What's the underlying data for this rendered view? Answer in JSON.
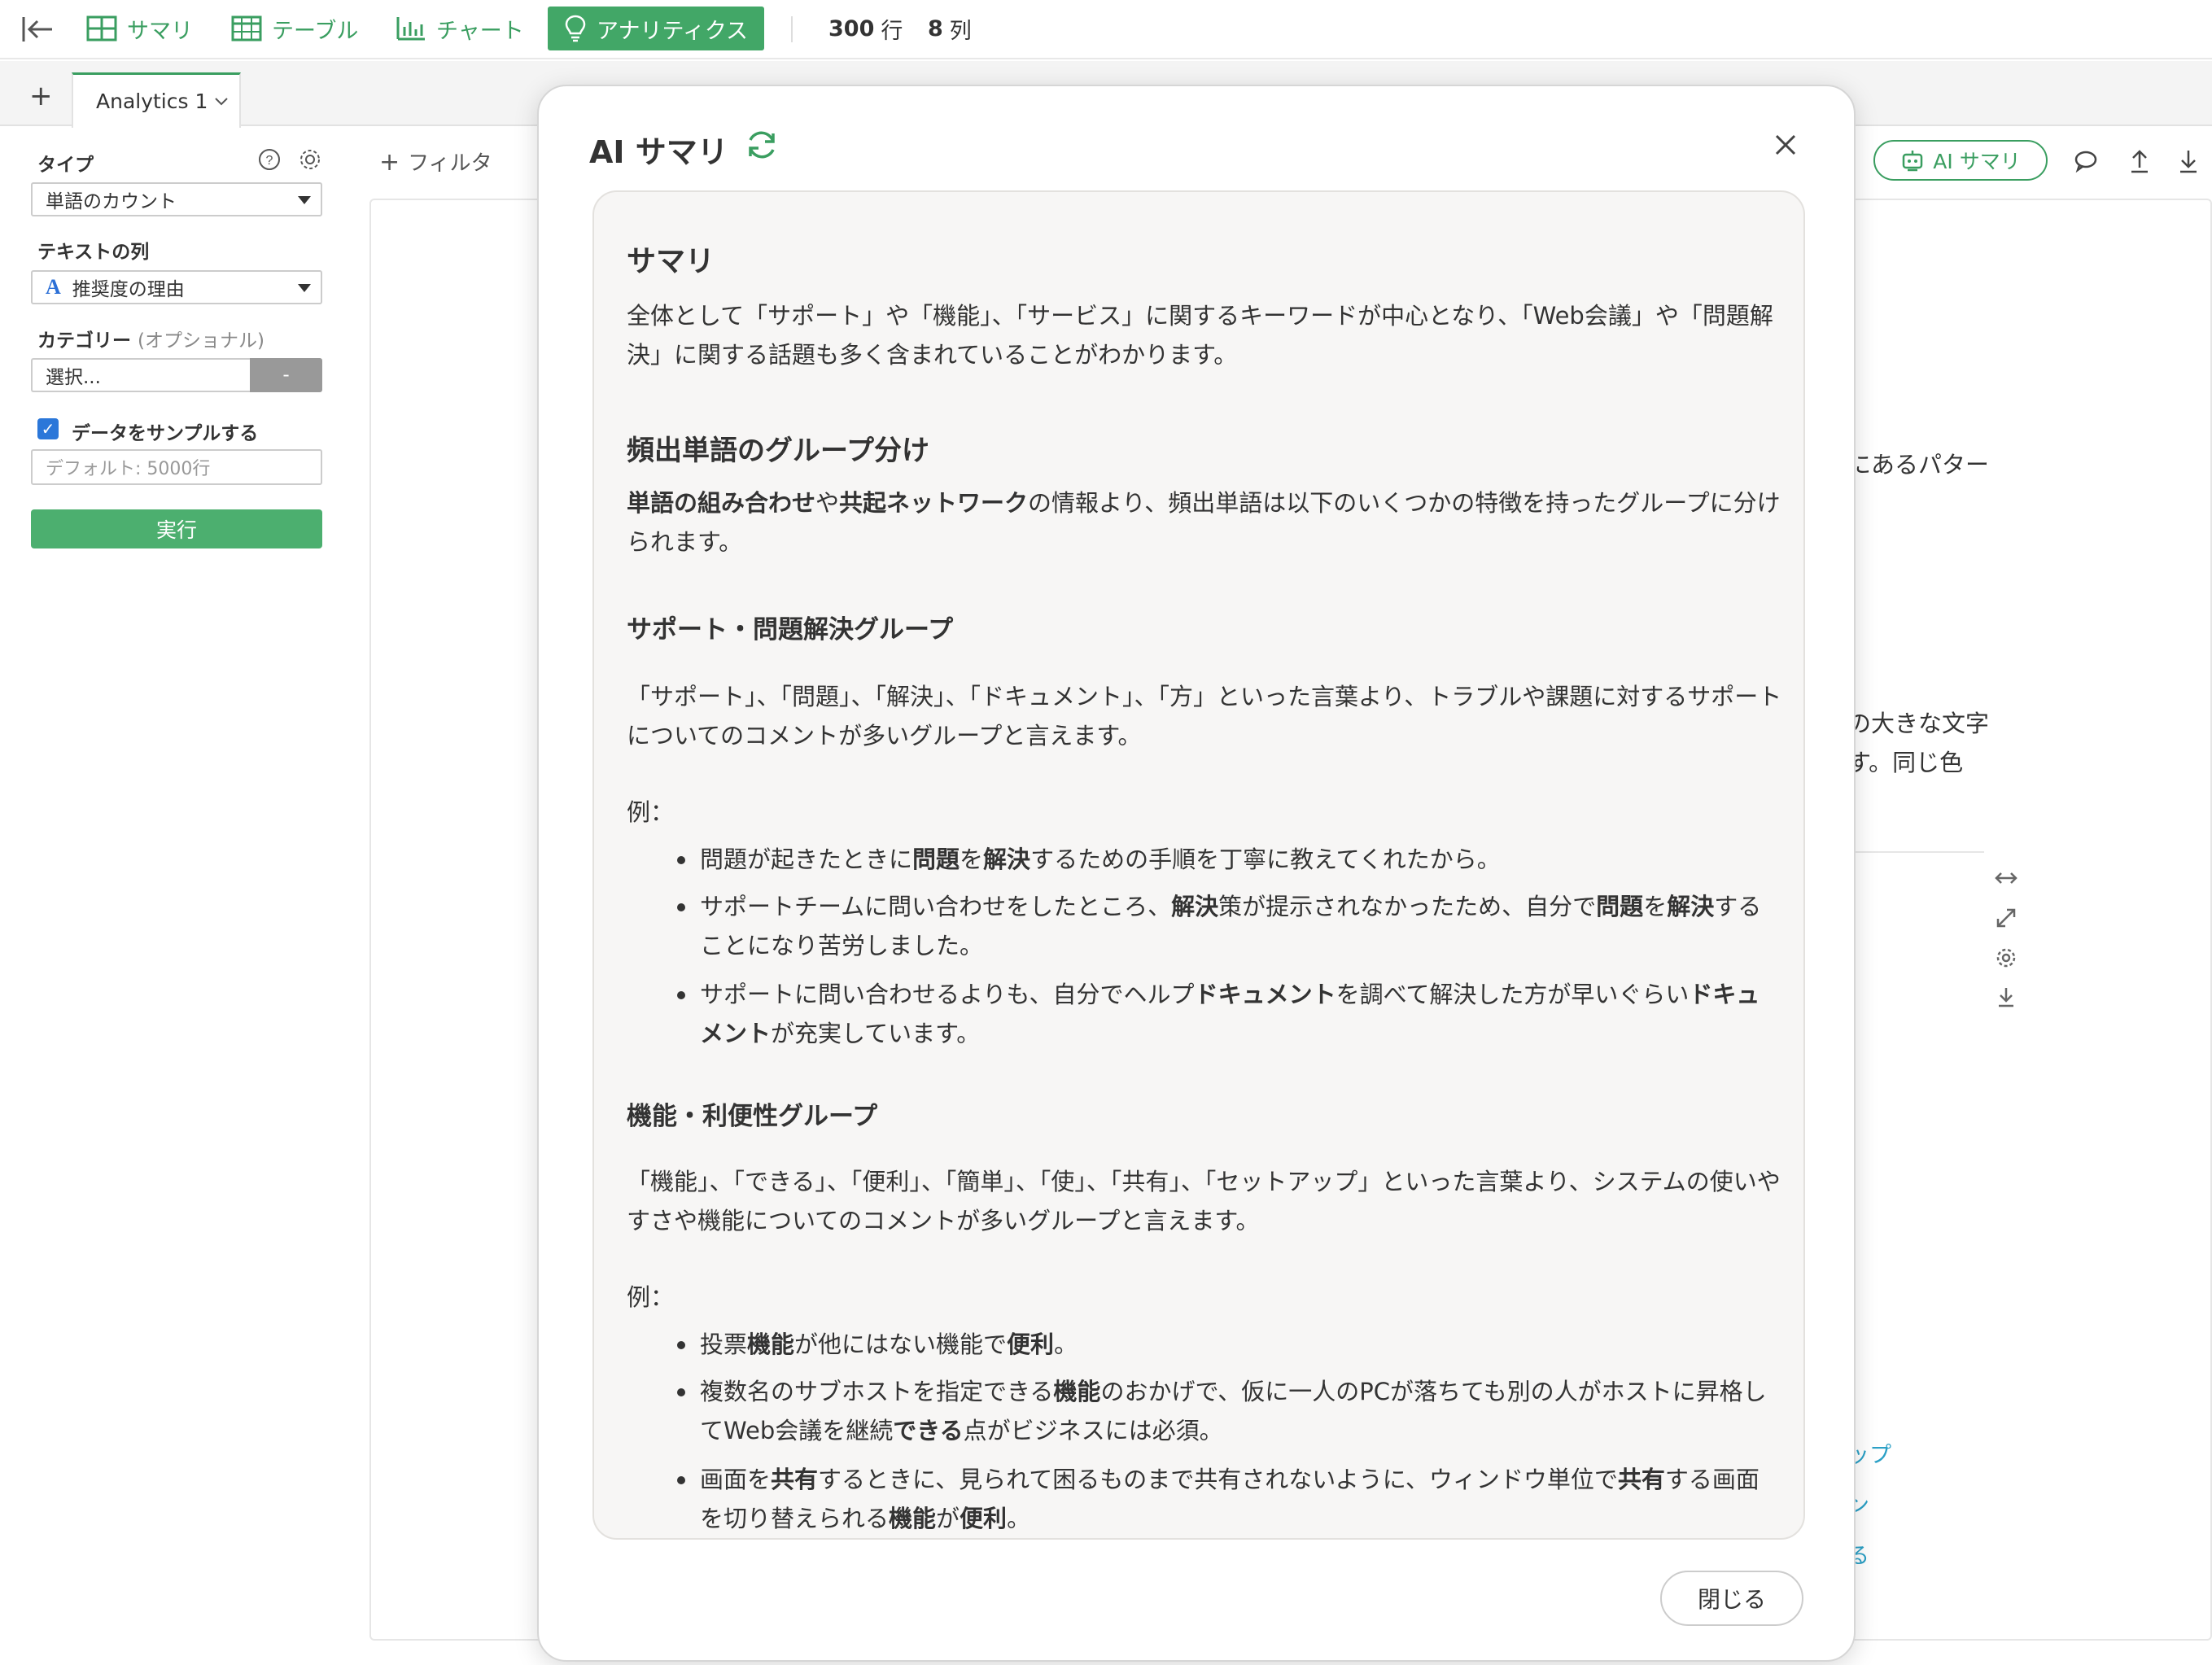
{
  "topbar": {
    "summary_label": "サマリ",
    "table_label": "テーブル",
    "chart_label": "チャート",
    "analytics_label": "アナリティクス",
    "rows_num": "300",
    "rows_unit": "行",
    "cols_num": "8",
    "cols_unit": "列"
  },
  "tabbar": {
    "add_label": "+",
    "tab_label": "Analytics 1"
  },
  "sidebar": {
    "type_label": "タイプ",
    "type_value": "単語のカウント",
    "text_col_label": "テキストの列",
    "text_col_value": "推奨度の理由",
    "category_label": "カテゴリー",
    "category_optional": "(オプショナル)",
    "category_placeholder": "選択...",
    "category_btn": "-",
    "sample_label": "データをサンプルする",
    "sample_checked": true,
    "sample_placeholder": "デフォルト: 5000行",
    "run_label": "実行"
  },
  "main": {
    "filter_label": "フィルタ",
    "ai_summary_btn": "AI サマリ",
    "bg_text_1": "にあるパター",
    "bg_text_2": "の大きな文字",
    "bg_text_3": "す。同じ色",
    "bg_link_1": "ップ",
    "bg_link_2": "ン",
    "bg_link_3": "る"
  },
  "modal": {
    "title": "AI サマリ",
    "close_label": "閉じる",
    "summary_heading": "サマリ",
    "summary_text": "全体として「サポート」や「機能」、「サービス」に関するキーワードが中心となり、「Web会議」や「問題解決」に関する話題も多く含まれていることがわかります。",
    "group_heading": "頻出単語のグループ分け",
    "group_intro_b1": "単語の組み合わせ",
    "group_intro_t1": "や",
    "group_intro_b2": "共起ネットワーク",
    "group_intro_t2": "の情報より、頻出単語は以下のいくつかの特徴を持ったグループに分けられます。",
    "g1_heading": "サポート・問題解決グループ",
    "g1_desc": "「サポート」、「問題」、「解決」、「ドキュメント」、「方」といった言葉より、トラブルや課題に対するサポートについてのコメントが多いグループと言えます。",
    "g1_example_label": "例：",
    "g1_ex1_a": "問題が起きたときに",
    "g1_ex1_b": "問題",
    "g1_ex1_c": "を",
    "g1_ex1_d": "解決",
    "g1_ex1_e": "するための手順を丁寧に教えてくれたから。",
    "g1_ex2_a": "サポートチームに問い合わせをしたところ、",
    "g1_ex2_b": "解決",
    "g1_ex2_c": "策が提示されなかったため、自分で",
    "g1_ex2_d": "問題",
    "g1_ex2_e": "を",
    "g1_ex2_f": "解決",
    "g1_ex2_g": "することになり苦労しました。",
    "g1_ex3_a": "サポートに問い合わせるよりも、自分でヘルプ",
    "g1_ex3_b": "ドキュメント",
    "g1_ex3_c": "を調べて解決した方が早いぐらい",
    "g1_ex3_d": "ドキュメント",
    "g1_ex3_e": "が充実しています。",
    "g2_heading": "機能・利便性グループ",
    "g2_desc": "「機能」、「できる」、「便利」、「簡単」、「使」、「共有」、「セットアップ」といった言葉より、システムの使いやすさや機能についてのコメントが多いグループと言えます。",
    "g2_example_label": "例：",
    "g2_ex1_a": "投票",
    "g2_ex1_b": "機能",
    "g2_ex1_c": "が他にはない機能で",
    "g2_ex1_d": "便利",
    "g2_ex1_e": "。",
    "g2_ex2_a": "複数名のサブホストを指定できる",
    "g2_ex2_b": "機能",
    "g2_ex2_c": "のおかげで、仮に一人のPCが落ちても別の人がホストに昇格してWeb会議を継続",
    "g2_ex2_d": "できる",
    "g2_ex2_e": "点がビジネスには必須。",
    "g2_ex3_a": "画面を",
    "g2_ex3_b": "共有",
    "g2_ex3_c": "するときに、見られて困るものまで共有されないように、ウィンドウ単位で",
    "g2_ex3_d": "共有",
    "g2_ex3_e": "する画面を切り替えられる",
    "g2_ex3_f": "機能",
    "g2_ex3_g": "が",
    "g2_ex3_h": "便利",
    "g2_ex3_i": "。"
  }
}
